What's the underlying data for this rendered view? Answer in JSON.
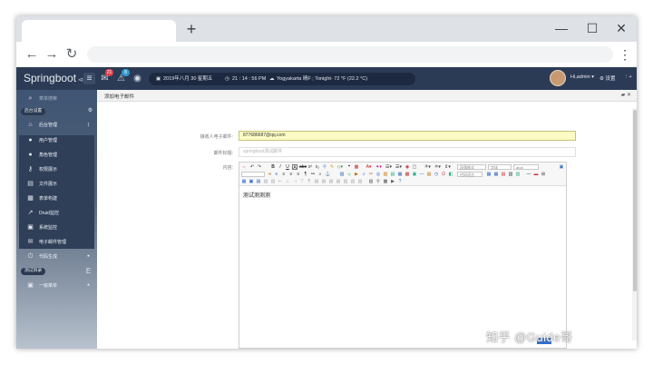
{
  "browser": {
    "new_tab": "+",
    "minimize": "—",
    "maximize": "☐",
    "close": "✕",
    "back": "←",
    "forward": "→",
    "reload": "↻",
    "menu": "⋮"
  },
  "header": {
    "brand": "Springboot",
    "brand_suffix": "⊲",
    "menu_toggle": "≡",
    "badge_messages": "21",
    "badge_alerts": "8",
    "date": "2019年八月 30 星期五",
    "time": "21 : 14 : 56 PM",
    "weather": "Yogyakarta  晴F ; Tonight- 72 °F (22.2 °C)",
    "user": "Hi,admin ▾",
    "settings": "设置",
    "more": "⋮+"
  },
  "sidebar": {
    "search": "菜单搜索",
    "group1": "后台设置",
    "group2": "测试目录",
    "items": [
      {
        "label": "后台管理",
        "icon": "home-icon"
      },
      {
        "label": "用户管理",
        "icon": "user-icon"
      },
      {
        "label": "角色管理",
        "icon": "users-icon"
      },
      {
        "label": "权限展示",
        "icon": "key-icon"
      },
      {
        "label": "文件展示",
        "icon": "file-icon"
      },
      {
        "label": "表单构建",
        "icon": "form-icon"
      },
      {
        "label": "Druid监控",
        "icon": "chart-icon"
      },
      {
        "label": "系统监控",
        "icon": "monitor-icon"
      },
      {
        "label": "电子邮件管理",
        "icon": "mail-icon"
      },
      {
        "label": "代码生成",
        "icon": "code-icon"
      },
      {
        "label": "一级菜单",
        "icon": "menu-icon"
      }
    ]
  },
  "content": {
    "tab_title": "添加电子邮件",
    "tab_tools": "▰ ✕",
    "recipient_label": "接收人电子邮件:",
    "recipient_value": "877686687@qq.com",
    "subject_label": "邮件标题:",
    "subject_placeholder": "springboot测试邮件",
    "body_label": "内容:",
    "body_text": "测试测测测",
    "font_select": "段落格式",
    "size_select": "字体",
    "family_select": "arial",
    "style_select": "代码语言"
  },
  "watermark": "知乎 @Guide哥"
}
